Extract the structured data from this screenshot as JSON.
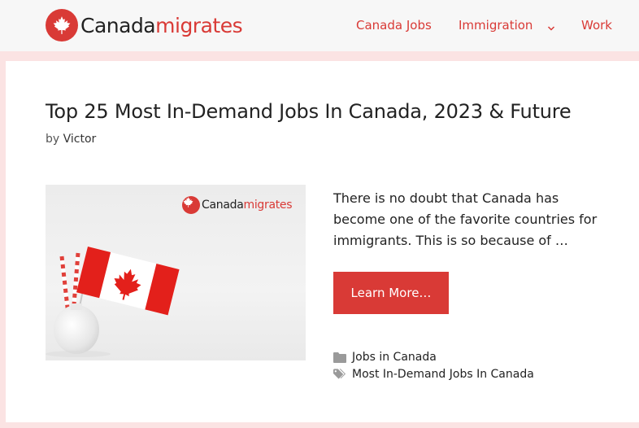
{
  "header": {
    "logo": {
      "part1": "Canada",
      "part2": "migrates",
      "icon": "maple-leaf-icon"
    },
    "nav": [
      {
        "label": "Canada Jobs"
      },
      {
        "label": "Immigration",
        "has_dropdown": true
      },
      {
        "label": "Work"
      }
    ]
  },
  "post": {
    "title": "Top 25 Most In-Demand Jobs In Canada, 2023 & Future",
    "byline_prefix": "by",
    "author": "Victor",
    "thumbnail": {
      "logo_part1": "Canada",
      "logo_part2": "migrates",
      "depicts": "canada-flag-in-vase"
    },
    "excerpt": "There is no doubt that Canada has become one of the favorite countries for immigrants. This is so because of …",
    "read_more_label": "Learn More…",
    "category": "Jobs in Canada",
    "tag": "Most In-Demand Jobs In Canada"
  },
  "colors": {
    "brand": "#d93a36",
    "page_background": "#fbe3e3",
    "header_background": "#f7f7f7",
    "card_background": "#ffffff"
  }
}
